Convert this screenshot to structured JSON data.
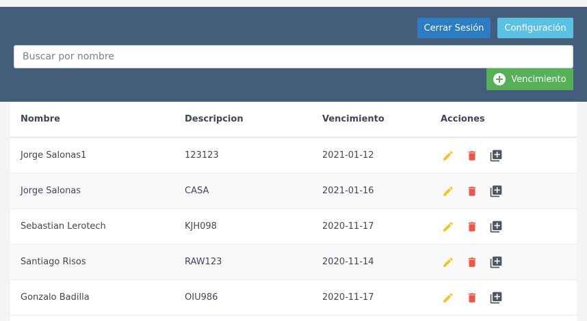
{
  "header": {
    "logout_label": "Cerrar Sesión",
    "config_label": "Configuración",
    "search_placeholder": "Buscar por nombre",
    "search_value": "",
    "add_label": "Vencimiento"
  },
  "table": {
    "columns": [
      "Nombre",
      "Descripcion",
      "Vencimiento",
      "Acciones"
    ],
    "rows": [
      {
        "nombre": "Jorge Salonas1",
        "descripcion": "123123",
        "vencimiento": "2021-01-12"
      },
      {
        "nombre": "Jorge Salonas",
        "descripcion": "CASA",
        "vencimiento": "2021-01-16"
      },
      {
        "nombre": "Sebastian Lerotech",
        "descripcion": "KJH098",
        "vencimiento": "2020-11-17"
      },
      {
        "nombre": "Santiago Risos",
        "descripcion": "RAW123",
        "vencimiento": "2020-11-14"
      },
      {
        "nombre": "Gonzalo Badilla",
        "descripcion": "OIU986",
        "vencimiento": "2020-11-17"
      }
    ],
    "actions": [
      "pencil-icon",
      "trash-icon",
      "library-add-icon"
    ]
  },
  "colors": {
    "header_bg": "#445d7b",
    "logout_bg": "#2b7cc2",
    "config_bg": "#5bc1e4",
    "add_bg": "#56b156",
    "edit_icon": "#f5c518",
    "delete_icon": "#f0544a",
    "add_icon": "#4b5563"
  }
}
